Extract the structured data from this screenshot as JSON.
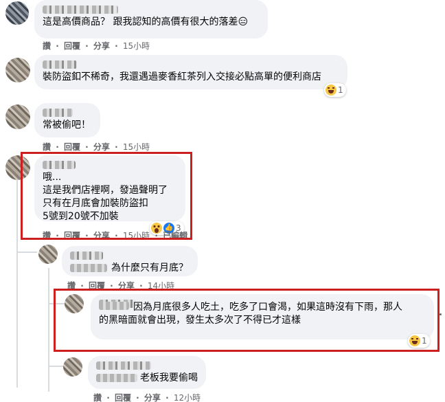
{
  "colors": {
    "highlight": "#cc1f1f",
    "bubble": "#f0f2f5",
    "meta": "#65676b"
  },
  "comments": [
    {
      "text": "這是高價商品？ 跟我認知的高價有很大的落差😑",
      "actions": [
        "讚",
        "回覆",
        "分享"
      ],
      "time": "15小時"
    },
    {
      "text": "裝防盜釦不稀奇，我還遇過麥香紅茶列入交接必點高單的便利商店",
      "reaction_count": "1",
      "reaction_icon": "haha-icon"
    },
    {
      "text": "常被偷吧！",
      "actions": [
        "讚",
        "回覆",
        "分享"
      ],
      "time": "15小時"
    },
    {
      "text": "哦...\n這是我們店裡啊，發過聲明了\n只有在月底會加裝防盜扣\n5號到20號不加裝",
      "actions": [
        "讚",
        "回覆",
        "分享"
      ],
      "time": "15小時",
      "edited": "已編輯",
      "reaction_count": "3",
      "reaction_icons": [
        "wow-icon",
        "like-icon"
      ]
    },
    {
      "text": "為什麼只有月底？",
      "actions": [
        "讚",
        "回覆",
        "分享"
      ],
      "time": "14小時"
    },
    {
      "text": "因為月底很多人吃土，吃多了口會渴，如果這時沒有下雨，那人\n的黑暗面就會出現，發生太多次了不得已才這樣",
      "reaction_count": "1",
      "reaction_icon": "haha-icon"
    },
    {
      "text": "老板我要偷喝",
      "actions": [
        "讚",
        "回覆",
        "分享"
      ],
      "time": "12小時"
    }
  ],
  "separator": "·"
}
